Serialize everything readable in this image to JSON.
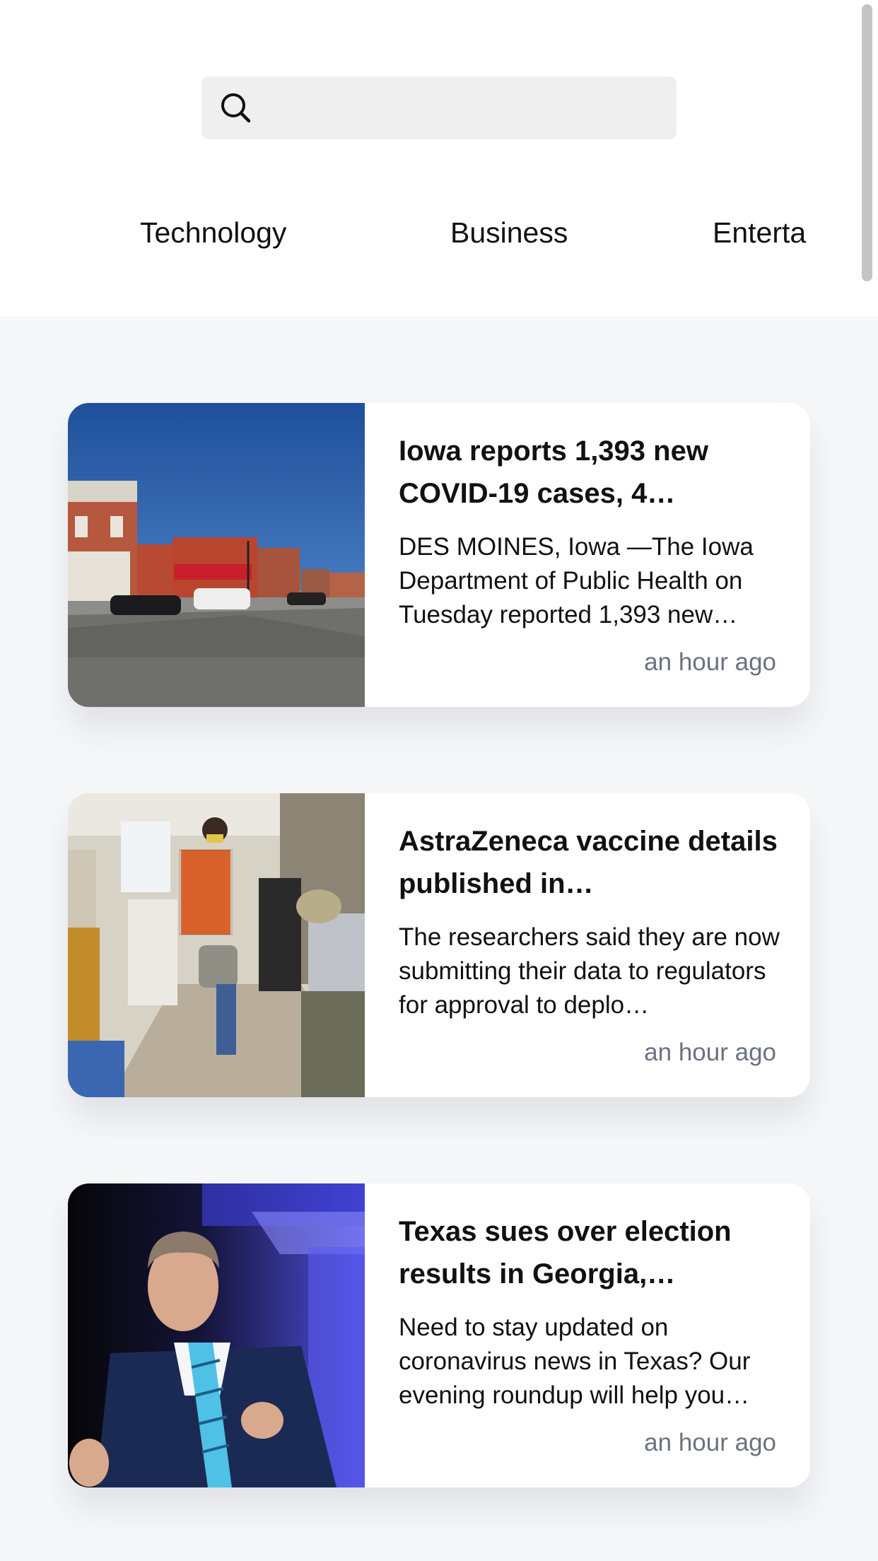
{
  "search": {
    "placeholder": "",
    "value": ""
  },
  "categories": [
    "Technology",
    "Business",
    "Enterta"
  ],
  "articles": [
    {
      "title": "Iowa reports 1,393 new COVID-19 cases, 4…",
      "summary": "DES MOINES, Iowa —The Iowa Department of Public Health on Tuesday reported 1,393 new…",
      "time": "an hour ago",
      "image": "street-photo"
    },
    {
      "title": "AstraZeneca vaccine details published in…",
      "summary": "The researchers said they are now submitting their data to regulators for approval to deplo…",
      "time": "an hour ago",
      "image": "clinic-photo"
    },
    {
      "title": "Texas sues over election results in Georgia,…",
      "summary": "Need to stay updated on coronavirus news in Texas? Our evening roundup will help you…",
      "time": "an hour ago",
      "image": "speaker-photo"
    }
  ],
  "colors": {
    "background": "#f6f7f9",
    "header": "#ffffff",
    "search_bg": "#efefef",
    "time_text": "#6b7280"
  }
}
